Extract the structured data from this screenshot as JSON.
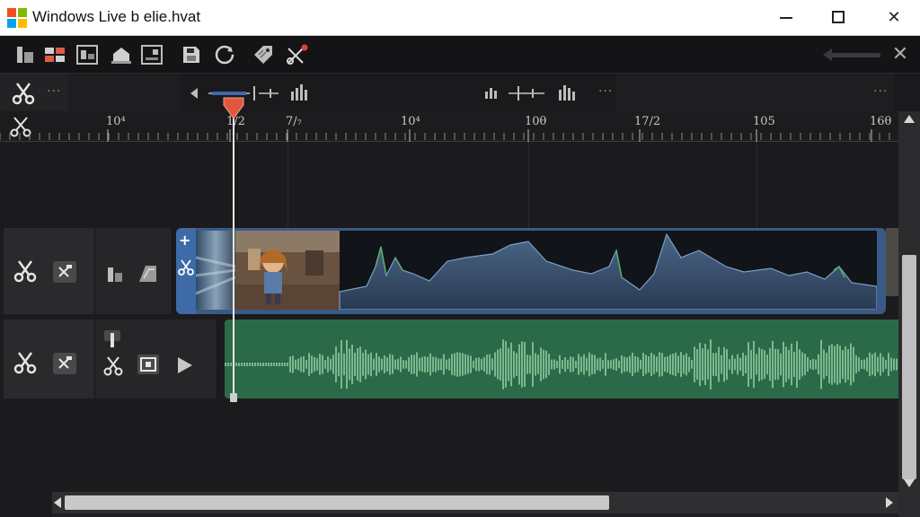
{
  "window": {
    "title": "Windows Live b elie.hvat",
    "logo_colors": [
      "#f25022",
      "#7fba00",
      "#00a4ef",
      "#ffb900"
    ],
    "close_glyph": "✕"
  },
  "toolbar": {
    "icons": [
      "clip-icon",
      "storyboard-icon",
      "titles-icon",
      "home-icon",
      "caption-icon",
      "save-icon",
      "rotate-icon",
      "tag-icon",
      "split-edit-icon"
    ],
    "close_glyph": "✕"
  },
  "controls": {
    "more_glyph": "···"
  },
  "ruler": {
    "labels": [
      "10⁴",
      "1/2",
      "7/₇",
      "10⁴",
      "10θ",
      "17/2",
      "105",
      "16θ"
    ]
  },
  "colors": {
    "accent_blue": "#3e6aa8",
    "audio_green": "#2a6a48",
    "playhead_red": "#e0583c"
  }
}
